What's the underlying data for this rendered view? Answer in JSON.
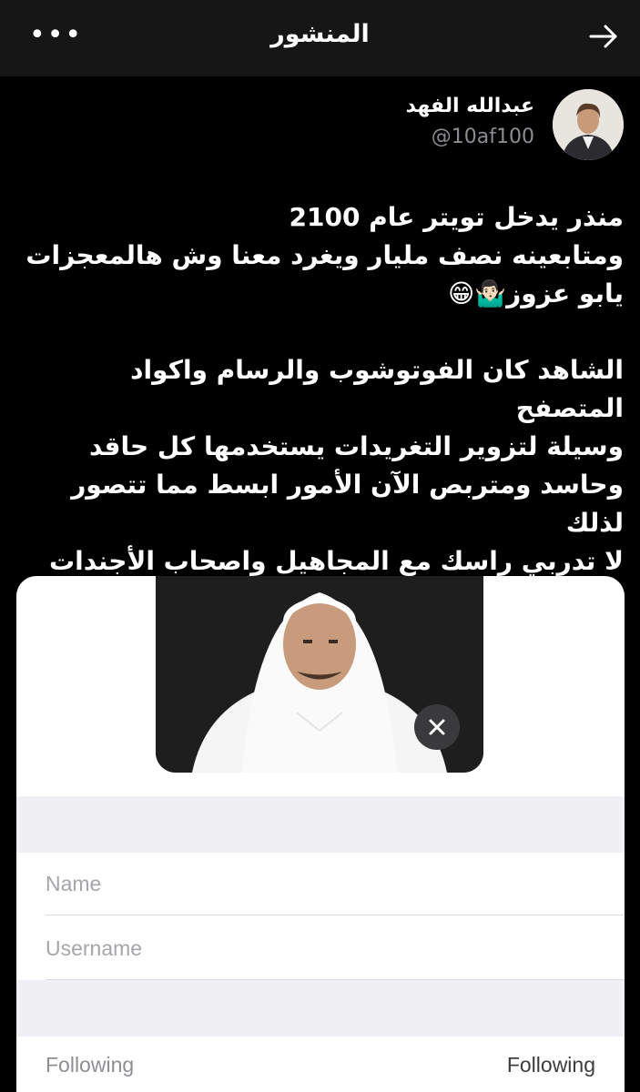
{
  "header": {
    "title": "المنشور",
    "menu_icon": "more-horizontal-icon",
    "back_icon": "arrow-right-icon"
  },
  "author": {
    "name": "عبدالله الفهد",
    "handle": "@10af100"
  },
  "tweet": {
    "text": "منذر يدخل تويتر عام 2100\nومتابعينه نصف مليار ويغرد معنا وش هالمعجزات\nيابو عزوز🤷🏻‍♂️😁\n\nالشاهد كان الفوتوشوب والرسام واكواد المتصفح\nوسيلة لتزوير التغريدات يستخدمها كل حاقد\nوحاسد ومتربص الآن الأمور ابسط مما تتصور لذلك\nلا تدربي راسك مع المجاهيل واصحاب الأجندات في\nتويتر ترى تأكل عدس ."
  },
  "embed": {
    "name_placeholder": "Name",
    "username_placeholder": "Username",
    "following_label": "Following",
    "following_value": "Following",
    "close_icon": "close-icon"
  }
}
